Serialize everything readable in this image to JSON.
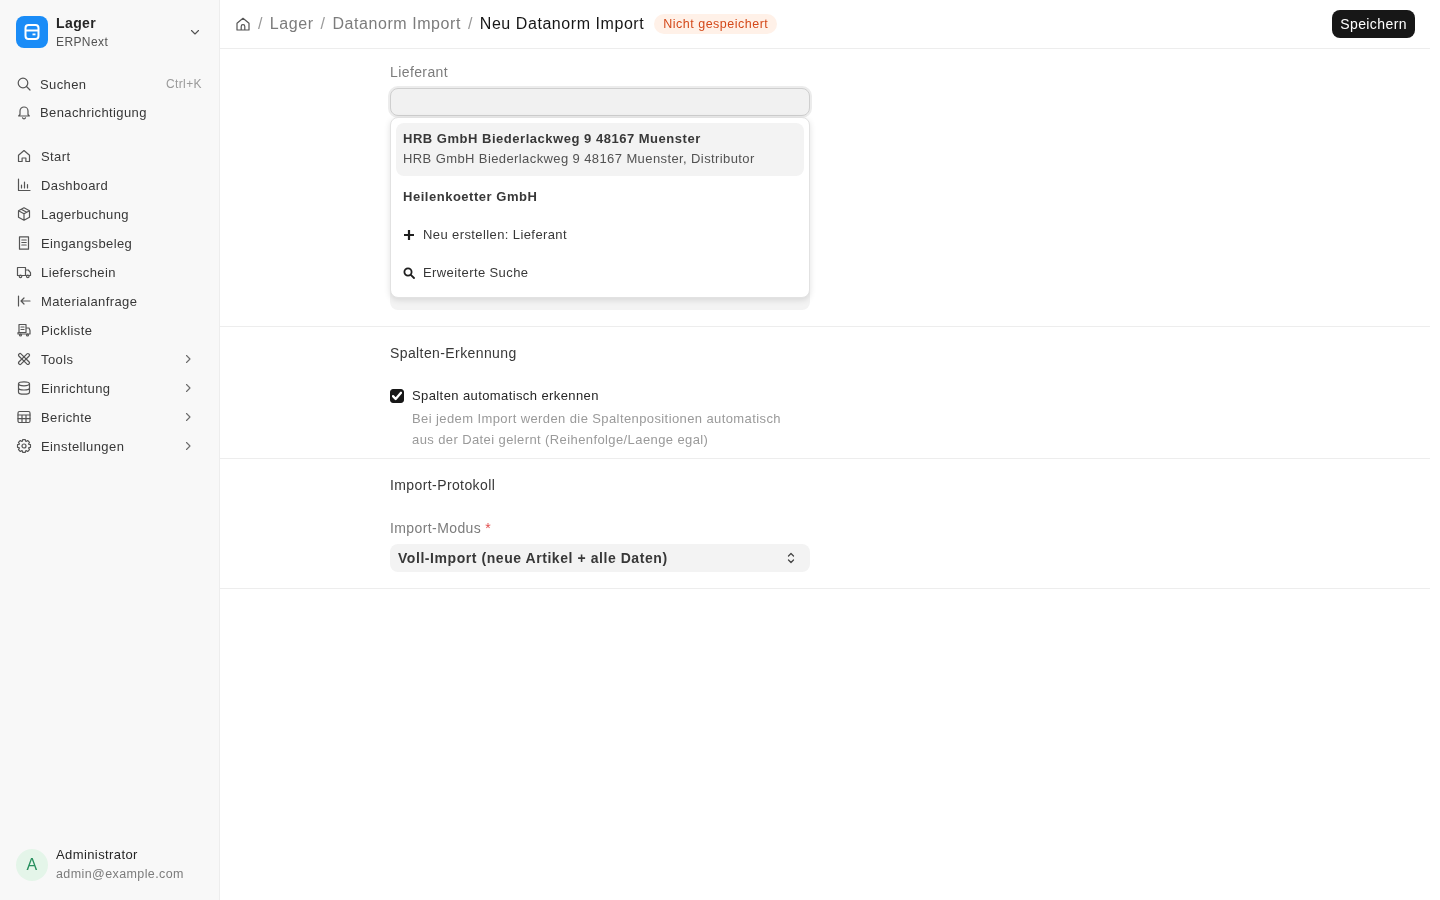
{
  "sidebar": {
    "app": {
      "title": "Lager",
      "subtitle": "ERPNext"
    },
    "search": {
      "label": "Suchen",
      "shortcut": "Ctrl+K"
    },
    "notifications": {
      "label": "Benachrichtigung"
    },
    "items": [
      {
        "label": "Start",
        "expandable": false
      },
      {
        "label": "Dashboard",
        "expandable": false
      },
      {
        "label": "Lagerbuchung",
        "expandable": false
      },
      {
        "label": "Eingangsbeleg",
        "expandable": false
      },
      {
        "label": "Lieferschein",
        "expandable": false
      },
      {
        "label": "Materialanfrage",
        "expandable": false
      },
      {
        "label": "Pickliste",
        "expandable": false
      },
      {
        "label": "Tools",
        "expandable": true
      },
      {
        "label": "Einrichtung",
        "expandable": true
      },
      {
        "label": "Berichte",
        "expandable": true
      },
      {
        "label": "Einstellungen",
        "expandable": true
      }
    ],
    "user": {
      "initial": "A",
      "name": "Administrator",
      "email": "admin@example.com"
    }
  },
  "header": {
    "breadcrumbs": [
      {
        "separator": "/",
        "label": "Lager",
        "current": false
      },
      {
        "separator": "/",
        "label": "Datanorm Import",
        "current": false
      },
      {
        "separator": "/",
        "label": "Neu Datanorm Import",
        "current": true
      }
    ],
    "status_badge": "Nicht gespeichert",
    "save_button": "Speichern"
  },
  "form": {
    "sections": [
      {
        "fields": [
          {
            "kind": "link",
            "label": "Lieferant",
            "focused": true,
            "dropdown": [
              {
                "kind": "option",
                "title": "HRB GmbH Biederlackweg 9 48167 Muenster",
                "description": "HRB GmbH Biederlackweg 9 48167 Muenster, Distributor",
                "selected": true
              },
              {
                "kind": "option",
                "title": "Heilenkoetter GmbH",
                "selected": false
              },
              {
                "kind": "create",
                "label": "Neu erstellen: Lieferant"
              },
              {
                "kind": "search",
                "label": "Erweiterte Suche"
              }
            ]
          },
          {
            "kind": "input"
          }
        ]
      },
      {
        "title": "Spalten-Erkennung",
        "fields": [
          {
            "kind": "checkbox",
            "label": "Spalten automatisch erkennen",
            "checked": true,
            "description": "Bei jedem Import werden die Spaltenpositionen automatisch aus der Datei gelernt (Reihenfolge/Laenge egal)"
          }
        ]
      },
      {
        "title": "Import-Protokoll",
        "fields": [
          {
            "kind": "select",
            "label": "Import-Modus",
            "required_mark": "*",
            "value": "Voll-Import (neue Artikel + alle Daten)"
          }
        ]
      }
    ]
  }
}
